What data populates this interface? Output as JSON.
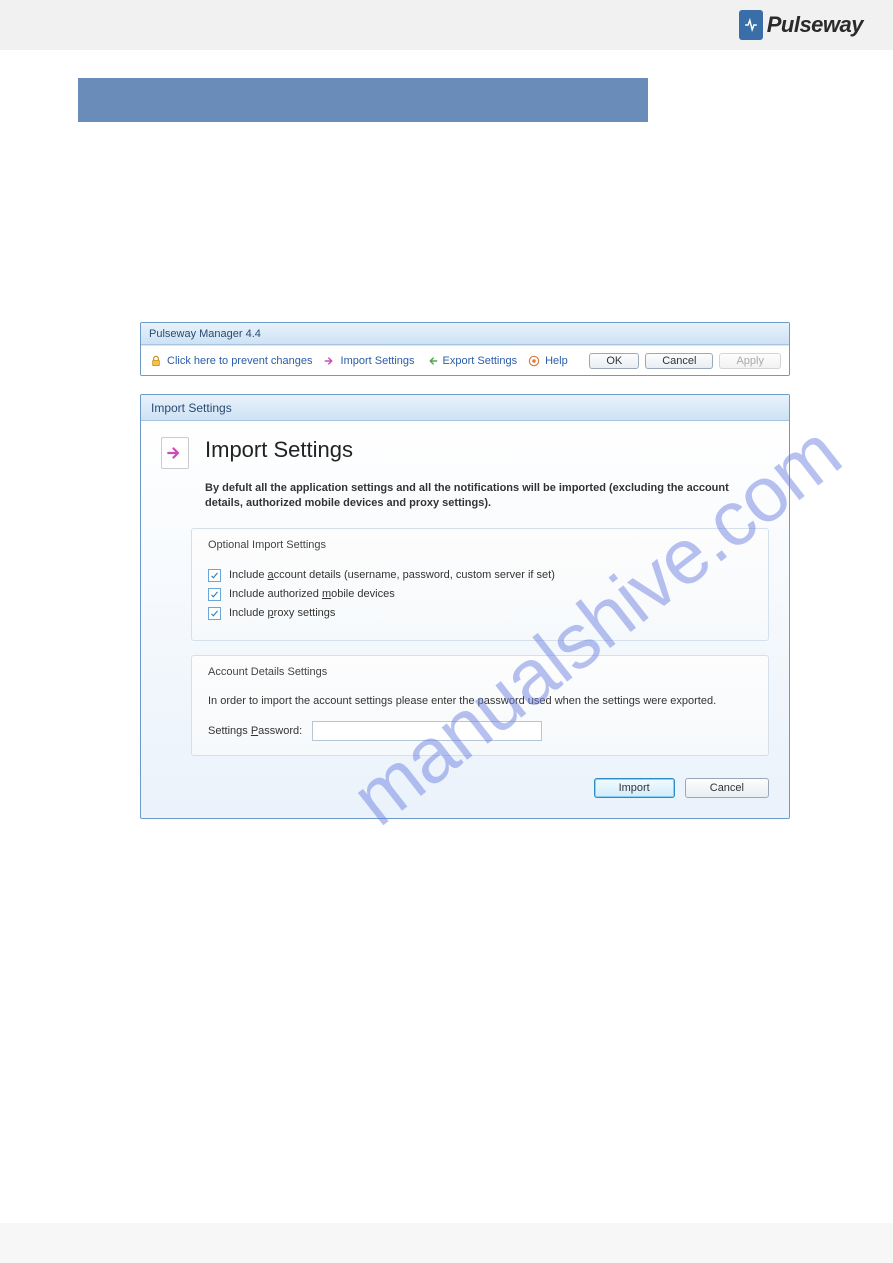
{
  "brand": {
    "name": "Pulseway"
  },
  "watermark": "manualshive.com",
  "toolbar_window": {
    "title": "Pulseway Manager 4.4",
    "links": {
      "prevent": "Click here to prevent changes",
      "import": "Import Settings",
      "export": "Export Settings",
      "help": "Help"
    },
    "buttons": {
      "ok": "OK",
      "cancel": "Cancel",
      "apply": "Apply"
    }
  },
  "import_dialog": {
    "window_title": "Import Settings",
    "hero_title": "Import Settings",
    "description": "By defult all the application settings and all the notifications will be imported (excluding the account details, authorized mobile devices and proxy settings).",
    "optional_group": {
      "legend": "Optional Import Settings",
      "check1_pre": "Include ",
      "check1_u": "a",
      "check1_post": "ccount details (username, password, custom server if set)",
      "check2_pre": "Include authorized ",
      "check2_u": "m",
      "check2_post": "obile devices",
      "check3_pre": "Include ",
      "check3_u": "p",
      "check3_post": "roxy settings"
    },
    "account_group": {
      "legend": "Account Details Settings",
      "info": "In order to import the account settings please enter the password used when the settings were exported.",
      "pw_label_pre": "Settings ",
      "pw_label_u": "P",
      "pw_label_post": "assword:"
    },
    "buttons": {
      "import": "Import",
      "cancel": "Cancel"
    }
  }
}
